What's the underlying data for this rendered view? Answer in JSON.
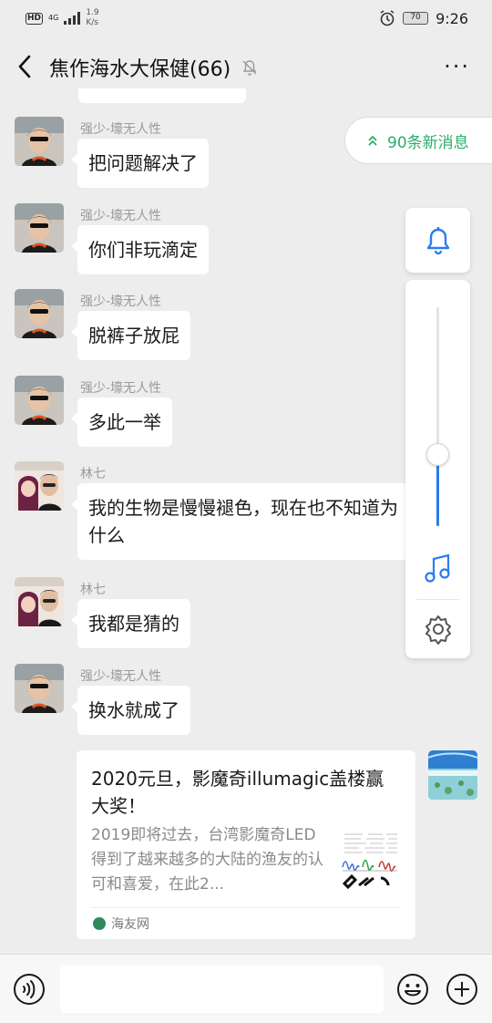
{
  "status": {
    "hd": "HD",
    "signal": "4G",
    "speed_value": "1.9",
    "speed_unit": "K/s",
    "battery": "70",
    "time": "9:26"
  },
  "header": {
    "title": "焦作海水大保健(66)",
    "more": "···"
  },
  "new_messages": {
    "label": "90条新消息"
  },
  "messages": [
    {
      "name": "强少-壕无人性",
      "text": "把问题解决了"
    },
    {
      "name": "强少-壕无人性",
      "text": "你们非玩滴定"
    },
    {
      "name": "强少-壕无人性",
      "text": "脱裤子放屁"
    },
    {
      "name": "强少-壕无人性",
      "text": "多此一举"
    },
    {
      "name": "林七",
      "text": "我的生物是慢慢褪色，现在也不知道为什么"
    },
    {
      "name": "林七",
      "text": "我都是猜的"
    },
    {
      "name": "强少-壕无人性",
      "text": "换水就成了"
    }
  ],
  "link_card": {
    "title": "2020元旦，影魔奇illumagic盖楼赢大奖！",
    "desc": "2019即将过去，台湾影魔奇LED得到了越来越多的大陆的渔友的认可和喜爱，在此2...",
    "source": "海友网"
  },
  "volume_panel": {
    "level": 0.33
  },
  "colors": {
    "accent_green": "#2aae67",
    "accent_blue": "#2b7bf2",
    "bubble": "#ffffff",
    "background": "#ededed"
  }
}
